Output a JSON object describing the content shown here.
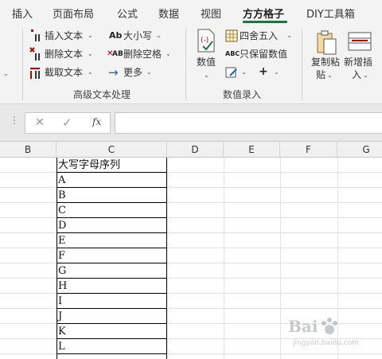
{
  "tabs": [
    "插入",
    "页面布局",
    "公式",
    "数据",
    "视图",
    "方方格子",
    "DIY工具箱"
  ],
  "ribbon": {
    "group_text": {
      "label": "高级文本处理",
      "insert_text": "插入文本",
      "delete_text": "删除文本",
      "cut_text": "截取文本",
      "case": "大小写",
      "delete_space": "删除空格",
      "more": "更多",
      "case_icon": "Ab",
      "space_icon": "AB"
    },
    "group_number": {
      "label": "数值录入",
      "value": "数值",
      "round": "四舍五入",
      "keep_value": "只保留数值",
      "plus": "+",
      "keep_icon": "ABC"
    },
    "group_copy": {
      "copy_paste_1": "复制粘",
      "copy_paste_2": "贴",
      "new_insert_1": "新增插",
      "new_insert_2": "入"
    }
  },
  "formula_bar": {
    "cancel": "✕",
    "confirm": "✓",
    "fx": "fx",
    "content": ""
  },
  "columns": [
    "B",
    "C",
    "D",
    "E",
    "F",
    "G"
  ],
  "cells": [
    "大写字母序列",
    "A",
    "B",
    "C",
    "D",
    "E",
    "F",
    "G",
    "H",
    "I",
    "J",
    "K",
    "L"
  ],
  "watermark": {
    "text": "Bai",
    "sub": "jingyan.baidu.com"
  },
  "colors": {
    "accent": "#217346",
    "ribbon_bg": "#f3f3f3",
    "red": "#c00000",
    "green": "#1e7b34",
    "blue": "#1f5fbf"
  }
}
